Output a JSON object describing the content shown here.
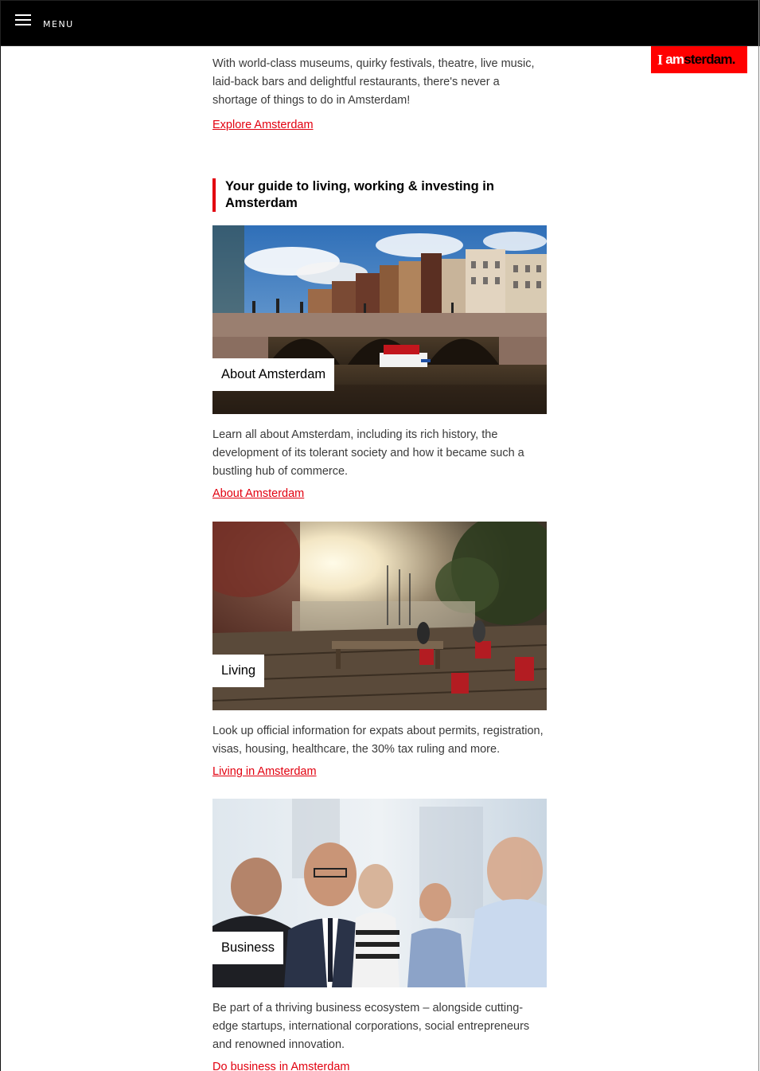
{
  "header": {
    "menu_label": "MENU",
    "logo": {
      "i": "I",
      "am": "am",
      "rest": "sterdam."
    }
  },
  "intro": {
    "text": "With world-class museums, quirky festivals, theatre, live music, laid-back bars and delightful restaurants, there's never a shortage of things to do in Amsterdam!",
    "link": "Explore Amsterdam"
  },
  "guide": {
    "heading": "Your guide to living, working & investing in Amsterdam"
  },
  "cards": [
    {
      "label": "About Amsterdam",
      "description": "Learn all about Amsterdam, including its rich history, the development of its tolerant society and how it became such a bustling hub of commerce.",
      "link": "About Amsterdam"
    },
    {
      "label": "Living",
      "description": "Look up official information for expats about permits, registration, visas, housing, healthcare, the 30% tax ruling and more.",
      "link": "Living in Amsterdam"
    },
    {
      "label": "Business",
      "description": "Be part of a thriving business ecosystem – alongside cutting-edge startups, international corporations, social entrepreneurs and renowned innovation.",
      "link": "Do business in Amsterdam"
    }
  ],
  "colors": {
    "accent": "#e2000f",
    "logo_bg": "#ff0000",
    "topbar": "#000000"
  }
}
